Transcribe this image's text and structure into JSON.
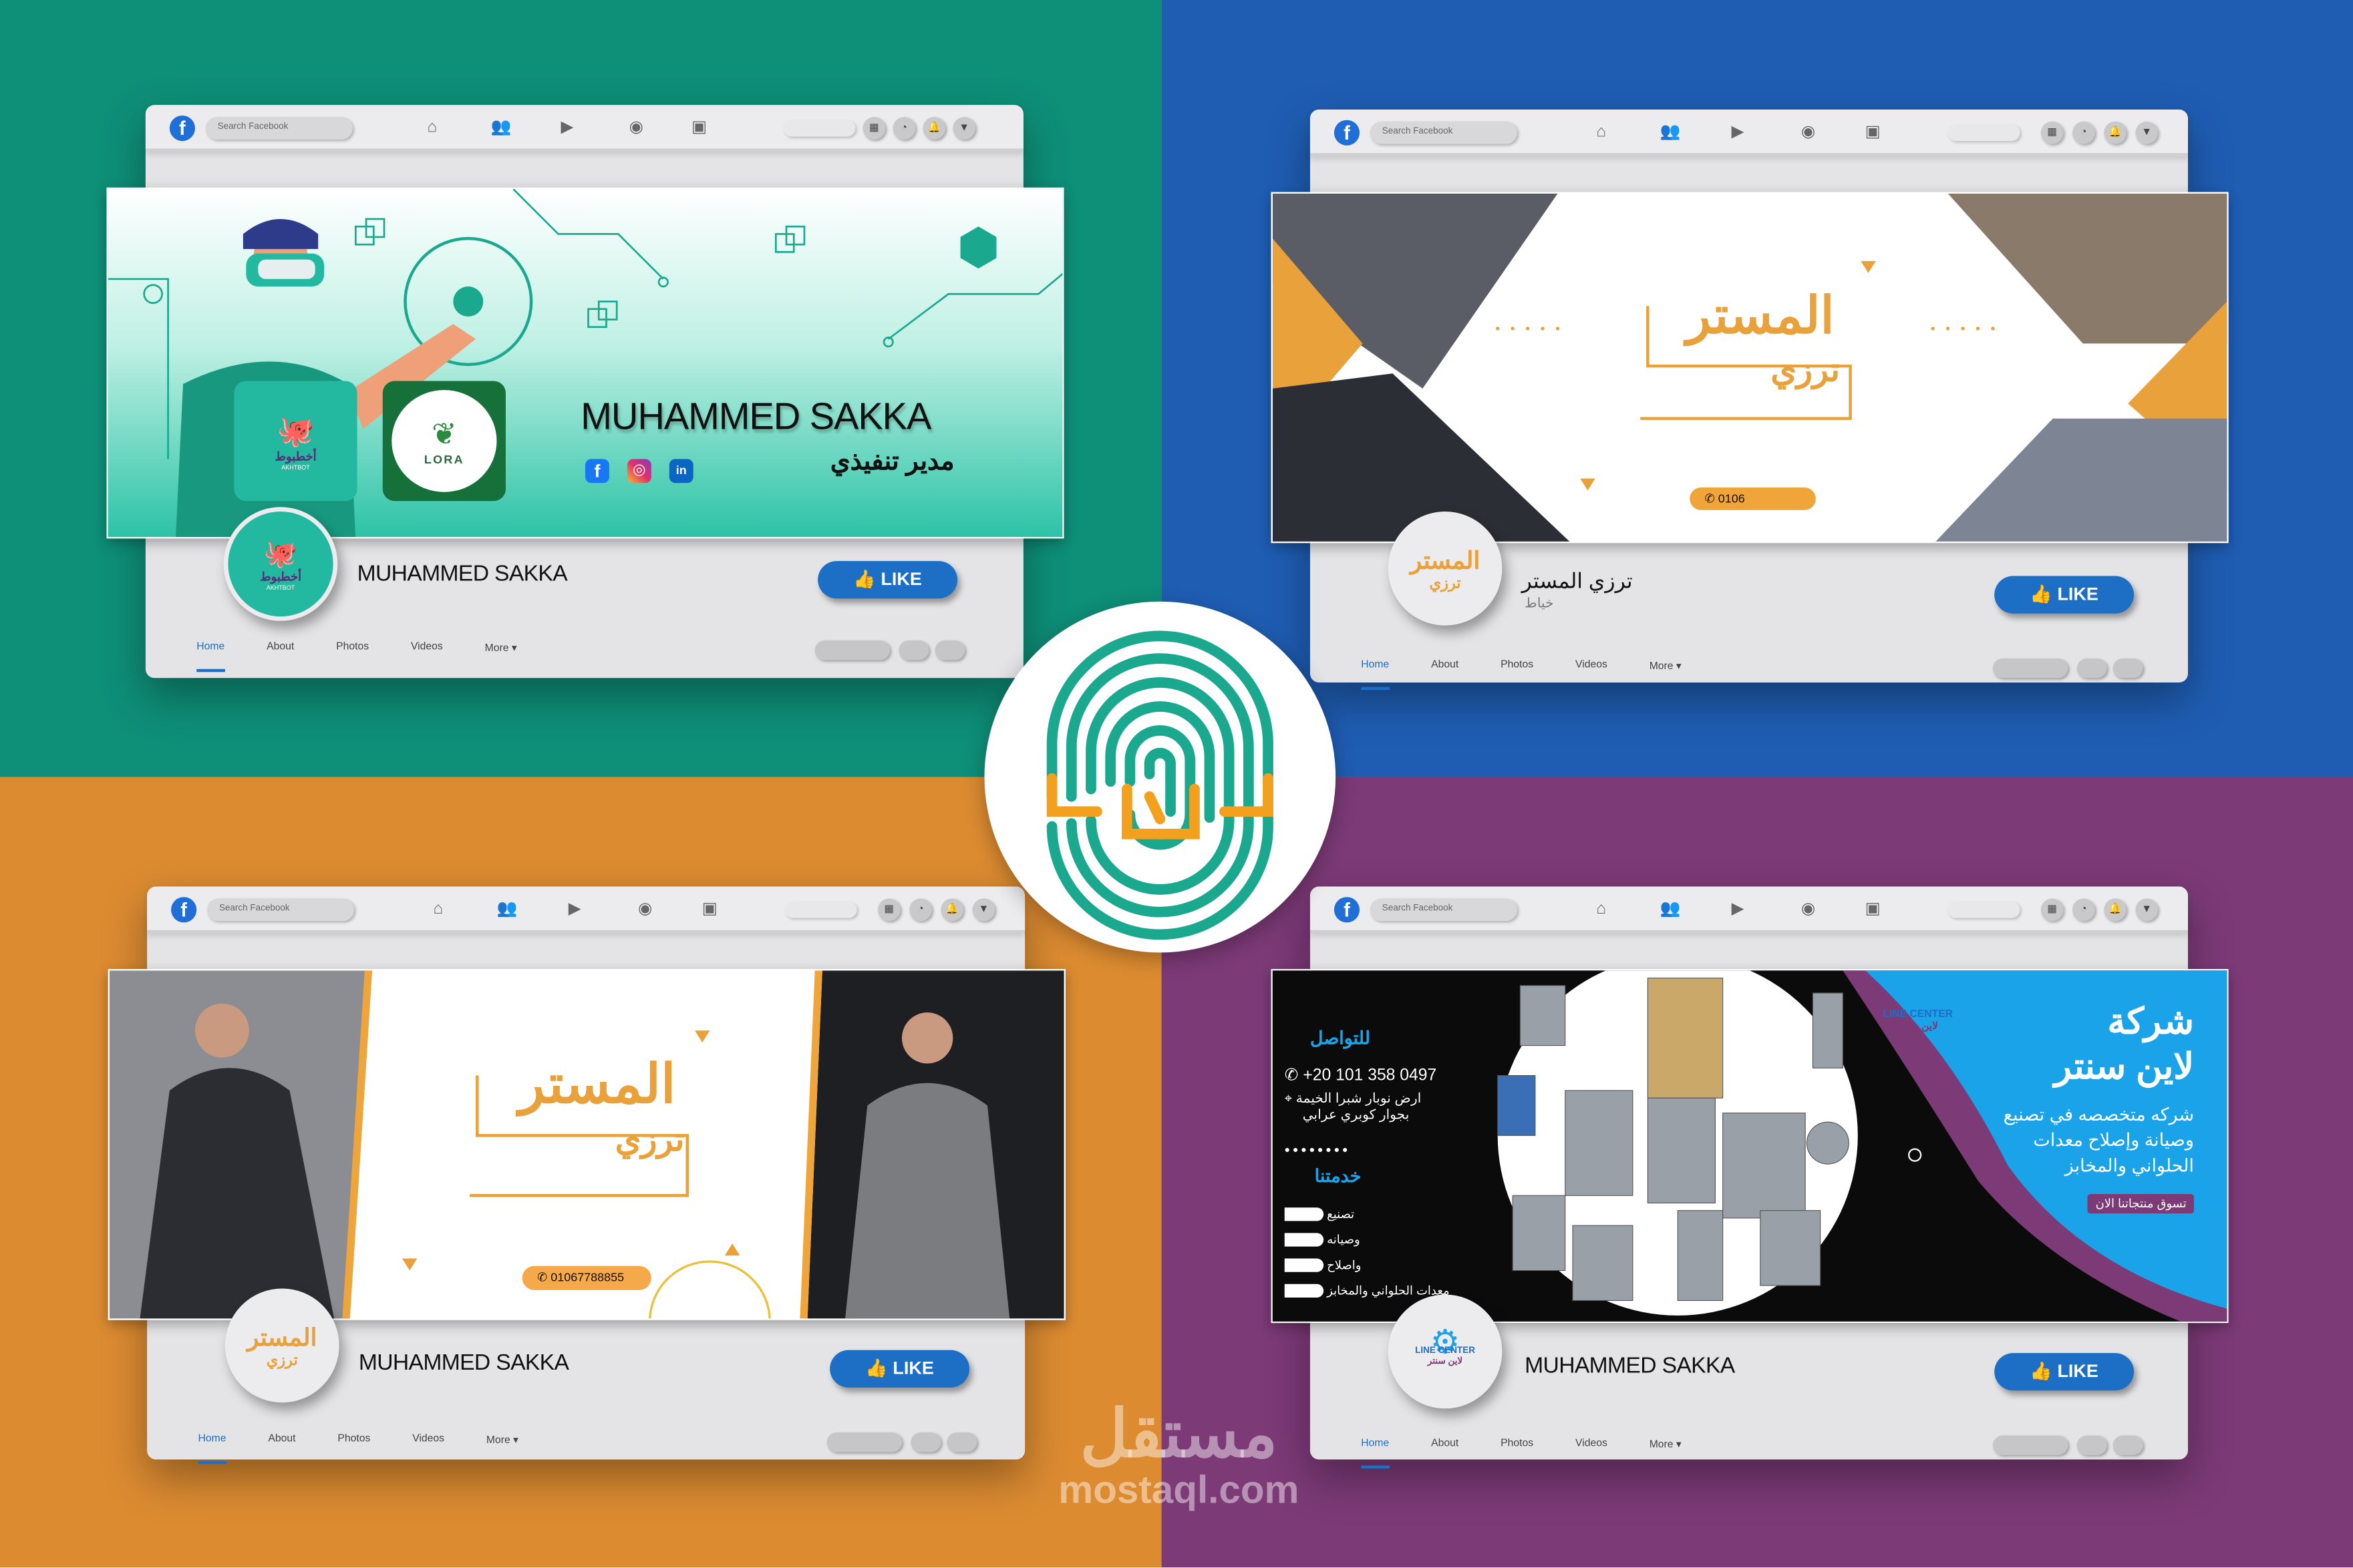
{
  "facebook": {
    "logo": "f",
    "search_placeholder": "Search Facebook",
    "nav_icons": [
      "home-icon",
      "friends-icon",
      "watch-icon",
      "groups-icon",
      "gaming-icon"
    ],
    "action_icons": [
      "menu-grid-icon",
      "messenger-icon",
      "bell-icon",
      "caret-down-icon"
    ],
    "tabs": [
      "Home",
      "About",
      "Photos",
      "Videos",
      "More ▾"
    ]
  },
  "cards": [
    {
      "cover": {
        "name": "MUHAMMED SAKKA",
        "title": "مدير تنفيذي",
        "logo1_ar": "أخطبوط",
        "logo1_en": "AKHTBOT",
        "logo2": "LORA",
        "social": [
          "facebook-icon",
          "instagram-icon",
          "linkedin-icon"
        ]
      },
      "avatar_ar": "أخطبوط",
      "avatar_en": "AKHTBOT",
      "page_name": "MUHAMMED SAKKA",
      "like": "LIKE"
    },
    {
      "cover": {
        "logo_main": "المستر",
        "logo_sub": "ترزي",
        "phone": "0106"
      },
      "avatar_main": "المستر",
      "avatar_sub": "ترزي",
      "page_name": "ترزي المستر",
      "page_category": "خياط",
      "like": "LIKE"
    },
    {
      "cover": {
        "logo_main": "المستر",
        "logo_sub": "ترزي",
        "phone": "01067788855"
      },
      "avatar_main": "المستر",
      "avatar_sub": "ترزي",
      "page_name": "MUHAMMED SAKKA",
      "like": "LIKE"
    },
    {
      "cover": {
        "contact_heading": "للتواصل",
        "phone": "+20 101 358 0497",
        "address_line1": "ارض نوبار شبرا الخيمة",
        "address_line2": "بجوار كوبري عرابي",
        "services_heading": "خدمتنا",
        "services": [
          "تصنيع",
          "وصيانه",
          "واصلاح",
          "معدات الحلواني والمخابز"
        ],
        "company_prefix": "شركة",
        "company_name": "لاين سنتر",
        "description": [
          "شركه متخصصه في تصنيع",
          "وصيانة وإصلاح معدات",
          "الحلواني والمخابز"
        ],
        "cta": "تسوق منتجاتنا الان",
        "logo_en": "LINE CENTER",
        "logo_ar": "لاين سنتر"
      },
      "avatar_en": "LINE CENTER",
      "avatar_ar": "لاين سنتر",
      "page_name": "MUHAMMED SAKKA",
      "like": "LIKE"
    }
  ],
  "watermark": {
    "ar": "مستقل",
    "en": "mostaql.com"
  },
  "colors": {
    "teal": "#0e8f78",
    "blue": "#1f5db3",
    "orange": "#dc8b31",
    "purple": "#7c3a77",
    "facebook_blue": "#1d6fc6",
    "logo_teal": "#1aa88f",
    "logo_orange": "#f2a01e"
  }
}
